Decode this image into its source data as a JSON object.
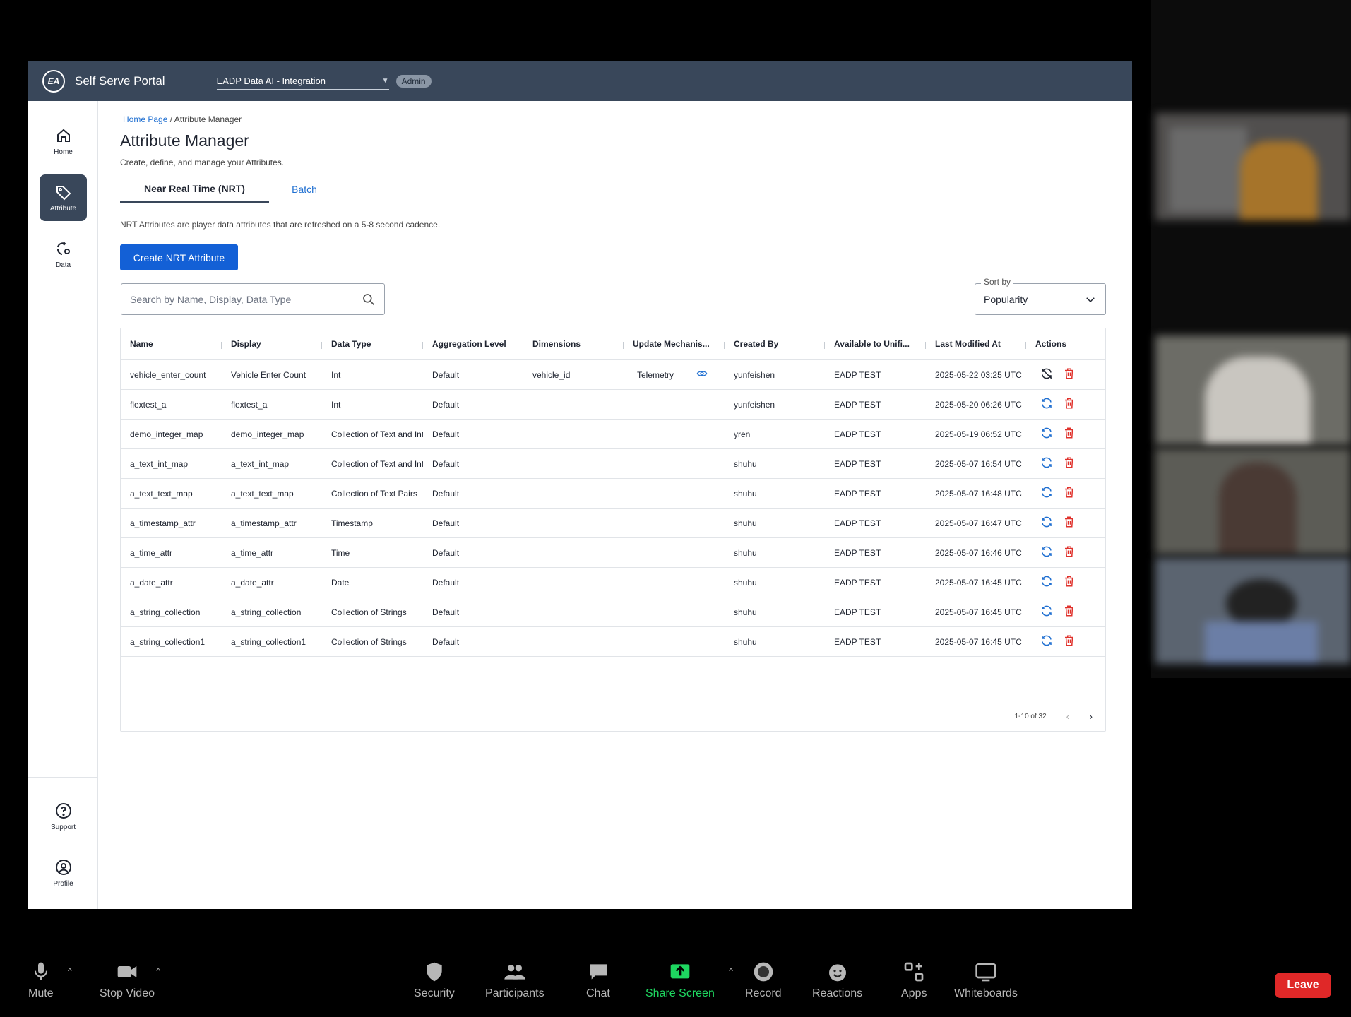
{
  "app": {
    "name": "Self Serve Portal",
    "logo_text": "EA",
    "workspace": "EADP Data AI - Integration",
    "role_badge": "Admin"
  },
  "sidebar": {
    "items": [
      {
        "label": "Home",
        "icon": "home-icon"
      },
      {
        "label": "Attribute",
        "icon": "tag-icon"
      },
      {
        "label": "Data",
        "icon": "data-sync-icon"
      }
    ],
    "bottom_items": [
      {
        "label": "Support",
        "icon": "help-icon"
      },
      {
        "label": "Profile",
        "icon": "profile-icon"
      }
    ]
  },
  "breadcrumb": {
    "home": "Home Page",
    "separator": "/",
    "current": "Attribute Manager"
  },
  "page": {
    "title": "Attribute Manager",
    "subtitle": "Create, define, and manage your Attributes."
  },
  "tabs": [
    {
      "label": "Near Real Time (NRT)",
      "active": true
    },
    {
      "label": "Batch",
      "active": false
    }
  ],
  "description": "NRT Attributes are player data attributes that are refreshed on a 5-8 second cadence.",
  "create_button": "Create NRT Attribute",
  "search": {
    "placeholder": "Search by Name, Display, Data Type"
  },
  "sort": {
    "legend": "Sort by",
    "value": "Popularity"
  },
  "table": {
    "columns": [
      "Name",
      "Display",
      "Data Type",
      "Aggregation Level",
      "Dimensions",
      "Update Mechanis...",
      "Created By",
      "Available to Unifi...",
      "Last Modified At",
      "Actions"
    ],
    "rows": [
      {
        "name": "vehicle_enter_count",
        "display": "Vehicle Enter Count",
        "data_type": "Int",
        "aggregation": "Default",
        "dimensions": "vehicle_id",
        "mechanism": "Telemetry",
        "created_by": "yunfeishen",
        "available": "EADP TEST",
        "modified": "2025-05-22 03:25 UTC",
        "action_icon": "sync-off-icon"
      },
      {
        "name": "flextest_a",
        "display": "flextest_a",
        "data_type": "Int",
        "aggregation": "Default",
        "dimensions": "",
        "mechanism": "",
        "created_by": "yunfeishen",
        "available": "EADP TEST",
        "modified": "2025-05-20 06:26 UTC",
        "action_icon": "sync-icon"
      },
      {
        "name": "demo_integer_map",
        "display": "demo_integer_map",
        "data_type": "Collection of Text and Int",
        "aggregation": "Default",
        "dimensions": "",
        "mechanism": "",
        "created_by": "yren",
        "available": "EADP TEST",
        "modified": "2025-05-19 06:52 UTC",
        "action_icon": "sync-icon"
      },
      {
        "name": "a_text_int_map",
        "display": "a_text_int_map",
        "data_type": "Collection of Text and Int",
        "aggregation": "Default",
        "dimensions": "",
        "mechanism": "",
        "created_by": "shuhu",
        "available": "EADP TEST",
        "modified": "2025-05-07 16:54 UTC",
        "action_icon": "sync-icon"
      },
      {
        "name": "a_text_text_map",
        "display": "a_text_text_map",
        "data_type": "Collection of Text Pairs",
        "aggregation": "Default",
        "dimensions": "",
        "mechanism": "",
        "created_by": "shuhu",
        "available": "EADP TEST",
        "modified": "2025-05-07 16:48 UTC",
        "action_icon": "sync-icon"
      },
      {
        "name": "a_timestamp_attr",
        "display": "a_timestamp_attr",
        "data_type": "Timestamp",
        "aggregation": "Default",
        "dimensions": "",
        "mechanism": "",
        "created_by": "shuhu",
        "available": "EADP TEST",
        "modified": "2025-05-07 16:47 UTC",
        "action_icon": "sync-icon"
      },
      {
        "name": "a_time_attr",
        "display": "a_time_attr",
        "data_type": "Time",
        "aggregation": "Default",
        "dimensions": "",
        "mechanism": "",
        "created_by": "shuhu",
        "available": "EADP TEST",
        "modified": "2025-05-07 16:46 UTC",
        "action_icon": "sync-icon"
      },
      {
        "name": "a_date_attr",
        "display": "a_date_attr",
        "data_type": "Date",
        "aggregation": "Default",
        "dimensions": "",
        "mechanism": "",
        "created_by": "shuhu",
        "available": "EADP TEST",
        "modified": "2025-05-07 16:45 UTC",
        "action_icon": "sync-icon"
      },
      {
        "name": "a_string_collection",
        "display": "a_string_collection",
        "data_type": "Collection of Strings",
        "aggregation": "Default",
        "dimensions": "",
        "mechanism": "",
        "created_by": "shuhu",
        "available": "EADP TEST",
        "modified": "2025-05-07 16:45 UTC",
        "action_icon": "sync-icon"
      },
      {
        "name": "a_string_collection1",
        "display": "a_string_collection1",
        "data_type": "Collection of Strings",
        "aggregation": "Default",
        "dimensions": "",
        "mechanism": "",
        "created_by": "shuhu",
        "available": "EADP TEST",
        "modified": "2025-05-07 16:45 UTC",
        "action_icon": "sync-icon"
      }
    ]
  },
  "pagination": {
    "range": "1-10 of 32"
  },
  "zoom_toolbar": {
    "mute": "Mute",
    "stop_video": "Stop Video",
    "security": "Security",
    "participants": "Participants",
    "chat": "Chat",
    "share_screen": "Share Screen",
    "record": "Record",
    "reactions": "Reactions",
    "apps": "Apps",
    "whiteboards": "Whiteboards",
    "leave": "Leave"
  },
  "colors": {
    "header": "#39475a",
    "primary": "#1360d6",
    "link": "#1f6fd1",
    "delete": "#e0312b",
    "share_green": "#1ed760",
    "leave": "#e02828"
  }
}
